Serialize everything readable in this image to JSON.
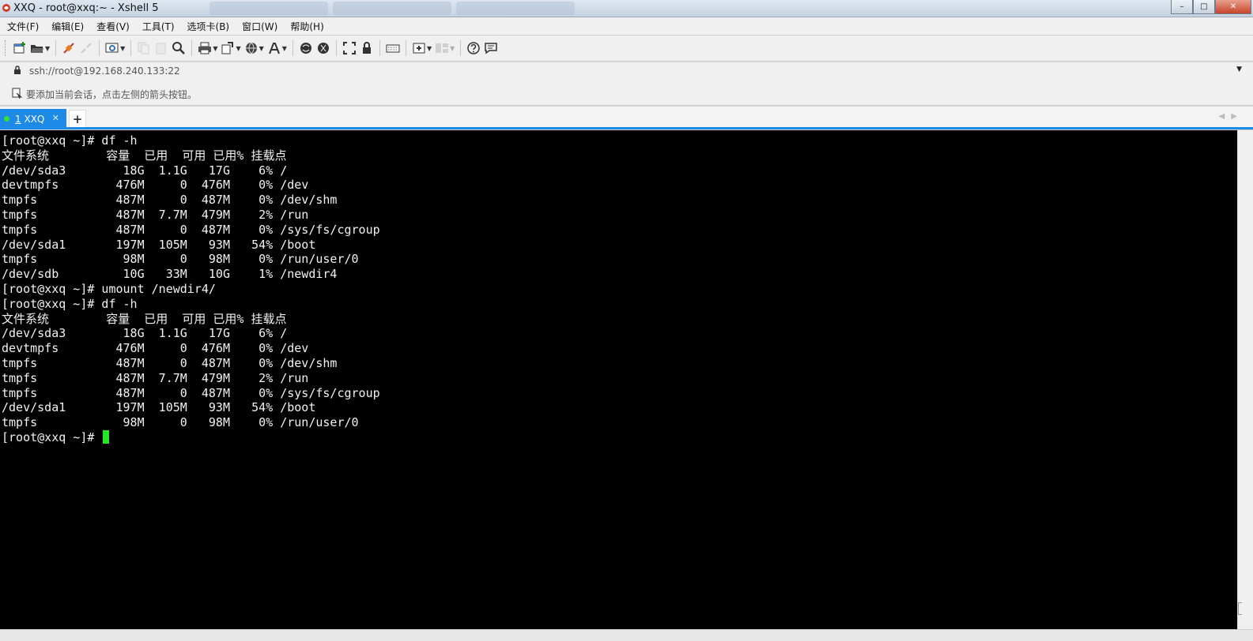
{
  "window": {
    "title": "XXQ - root@xxq:~ - Xshell 5",
    "accent_color": "#1e8ae8",
    "buttons": {
      "minimize": "–",
      "maximize": "□",
      "close": "✕"
    }
  },
  "menu": [
    "文件(F)",
    "编辑(E)",
    "查看(V)",
    "工具(T)",
    "选项卡(B)",
    "窗口(W)",
    "帮助(H)"
  ],
  "address": {
    "value": "ssh://root@192.168.240.133:22"
  },
  "hint": {
    "text": "要添加当前会话，点击左侧的箭头按钮。"
  },
  "tabs": [
    {
      "number": "1",
      "label": "XXQ",
      "status_color": "#34e234"
    }
  ],
  "terminal": {
    "cursor_color": "#23e823",
    "prompt": "[root@xxq ~]# ",
    "lines": [
      "[root@xxq ~]# df -h",
      "文件系统        容量  已用  可用 已用% 挂载点",
      "/dev/sda3        18G  1.1G   17G    6% /",
      "devtmpfs        476M     0  476M    0% /dev",
      "tmpfs           487M     0  487M    0% /dev/shm",
      "tmpfs           487M  7.7M  479M    2% /run",
      "tmpfs           487M     0  487M    0% /sys/fs/cgroup",
      "/dev/sda1       197M  105M   93M   54% /boot",
      "tmpfs            98M     0   98M    0% /run/user/0",
      "/dev/sdb         10G   33M   10G    1% /newdir4",
      "[root@xxq ~]# umount /newdir4/",
      "[root@xxq ~]# df -h",
      "文件系统        容量  已用  可用 已用% 挂载点",
      "/dev/sda3        18G  1.1G   17G    6% /",
      "devtmpfs        476M     0  476M    0% /dev",
      "tmpfs           487M     0  487M    0% /dev/shm",
      "tmpfs           487M  7.7M  479M    2% /run",
      "tmpfs           487M     0  487M    0% /sys/fs/cgroup",
      "/dev/sda1       197M  105M   93M   54% /boot",
      "tmpfs            98M     0   98M    0% /run/user/0"
    ]
  }
}
